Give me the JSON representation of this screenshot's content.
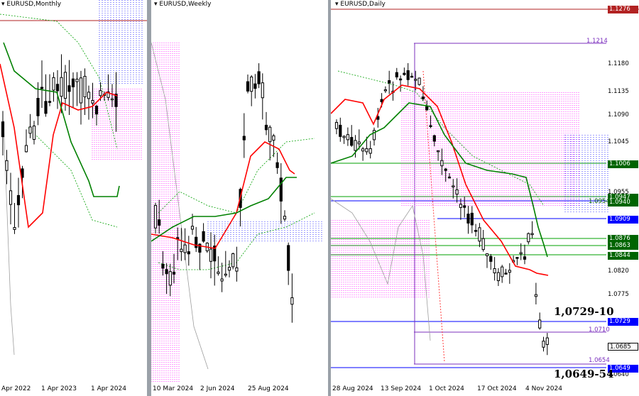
{
  "colors": {
    "bull": "#ffffff",
    "bear": "#000000",
    "tenkan": "#ff0000",
    "kijun": "#008000",
    "chikou": "#9e9e9e",
    "cloud_up": "#ff00ff",
    "cloud_dn": "#0000ff",
    "separator": "#9aa1a8"
  },
  "panels": [
    {
      "title": "EURUSD,Monthly",
      "xlabels": [
        "Apr 2022",
        "1 Apr 2023",
        "1 Apr 2024"
      ]
    },
    {
      "title": "EURUSD,Weekly",
      "xlabels": [
        "10 Mar 2024",
        "2 Jun 2024",
        "25 Aug 2024"
      ]
    },
    {
      "title": "EURUSD,Daily",
      "xlabels": [
        "28 Aug 2024",
        "13 Sep 2024",
        "1 Oct 2024",
        "17 Oct 2024",
        "4 Nov 2024"
      ]
    }
  ],
  "price_axis": {
    "labels": [
      "1.1180",
      "1.1135",
      "1.1090",
      "1.1045",
      "1.0955",
      "1.0820",
      "1.0775",
      "1.0640"
    ]
  },
  "highlight_labels": [
    {
      "text": "1.1276",
      "bg": "#b22222"
    },
    {
      "text": "1.0947",
      "bg": "#006400"
    },
    {
      "text": "1.0940",
      "bg": "#006400"
    },
    {
      "text": "1.1006",
      "bg": "#006400"
    },
    {
      "text": "1.0909",
      "bg": "#0000ff"
    },
    {
      "text": "1.0876",
      "bg": "#006400"
    },
    {
      "text": "1.0863",
      "bg": "#006400"
    },
    {
      "text": "1.0844",
      "bg": "#006400"
    },
    {
      "text": "1.0729",
      "bg": "#0000ff"
    },
    {
      "text": "1.0685",
      "bg": "#ffffff"
    },
    {
      "text": "1.0649",
      "bg": "#0000ff"
    }
  ],
  "level_labels": [
    "1.1214",
    "1.0954",
    "1.0710",
    "1.0654"
  ],
  "annotations": {
    "upper": "1,0729-10",
    "lower": "1,0649-54"
  },
  "chart_data": [
    {
      "type": "candlestick",
      "timeframe": "Monthly",
      "title": "EURUSD,Monthly",
      "x_ticks": [
        "Apr 2022",
        "1 Apr 2023",
        "1 Apr 2024"
      ],
      "indicator": "Ichimoku",
      "horizontal_levels": [
        1.1276
      ]
    },
    {
      "type": "candlestick",
      "timeframe": "Weekly",
      "title": "EURUSD,Weekly",
      "x_ticks": [
        "10 Mar 2024",
        "2 Jun 2024",
        "25 Aug 2024"
      ],
      "indicator": "Ichimoku"
    },
    {
      "type": "candlestick",
      "timeframe": "Daily",
      "title": "EURUSD,Daily",
      "x_ticks": [
        "28 Aug 2024",
        "13 Sep 2024",
        "1 Oct 2024",
        "17 Oct 2024",
        "4 Nov 2024"
      ],
      "indicator": "Ichimoku",
      "last_price": 1.0685,
      "y_ticks": [
        1.118,
        1.1135,
        1.109,
        1.1045,
        1.0955,
        1.082,
        1.0775,
        1.064
      ],
      "horizontal_levels": [
        1.1276,
        1.1214,
        1.1006,
        1.0954,
        1.0947,
        1.094,
        1.0909,
        1.0876,
        1.0863,
        1.0844,
        1.0729,
        1.071,
        1.0654,
        1.0649
      ],
      "annotations": [
        "1,0729-10",
        "1,0649-54"
      ]
    }
  ]
}
